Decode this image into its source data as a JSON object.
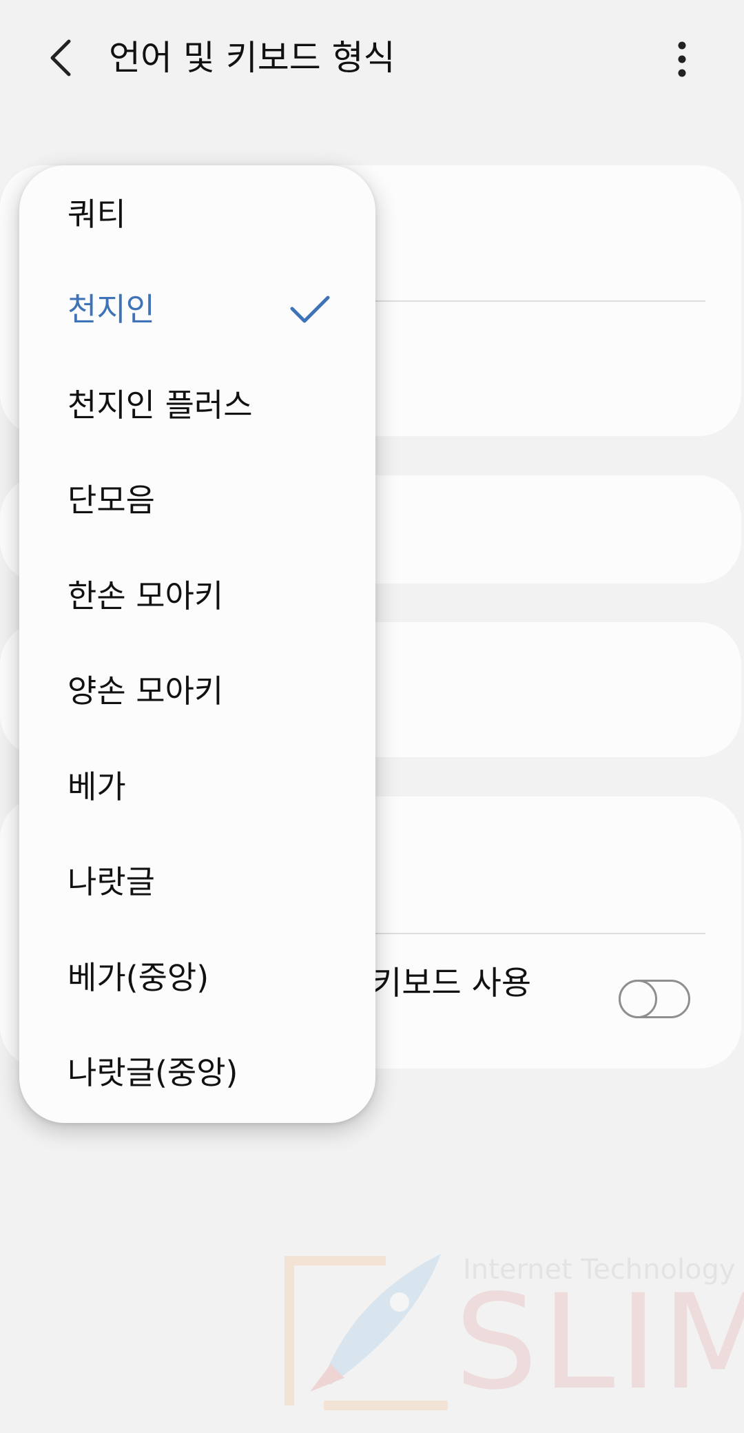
{
  "header": {
    "title": "언어 및 키보드 형식",
    "back_icon": "chevron-left-icon",
    "more_icon": "more-vertical-icon"
  },
  "settings": {
    "partial_item_label": "키보드 사용",
    "toggle_state": "off"
  },
  "dropdown": {
    "selected_index": 1,
    "items": [
      {
        "label": "쿼티",
        "selected": false
      },
      {
        "label": "천지인",
        "selected": true
      },
      {
        "label": "천지인 플러스",
        "selected": false
      },
      {
        "label": "단모음",
        "selected": false
      },
      {
        "label": "한손 모아키",
        "selected": false
      },
      {
        "label": "양손 모아키",
        "selected": false
      },
      {
        "label": "베가",
        "selected": false
      },
      {
        "label": "나랏글",
        "selected": false
      },
      {
        "label": "베가(중앙)",
        "selected": false
      },
      {
        "label": "나랏글(중앙)",
        "selected": false
      }
    ]
  },
  "watermark": {
    "tagline": "Internet Technology",
    "brand": "SLIM"
  },
  "colors": {
    "background": "#f2f2f2",
    "card": "#fcfcfc",
    "accent_selected": "#3e73b8",
    "text": "#111111"
  }
}
